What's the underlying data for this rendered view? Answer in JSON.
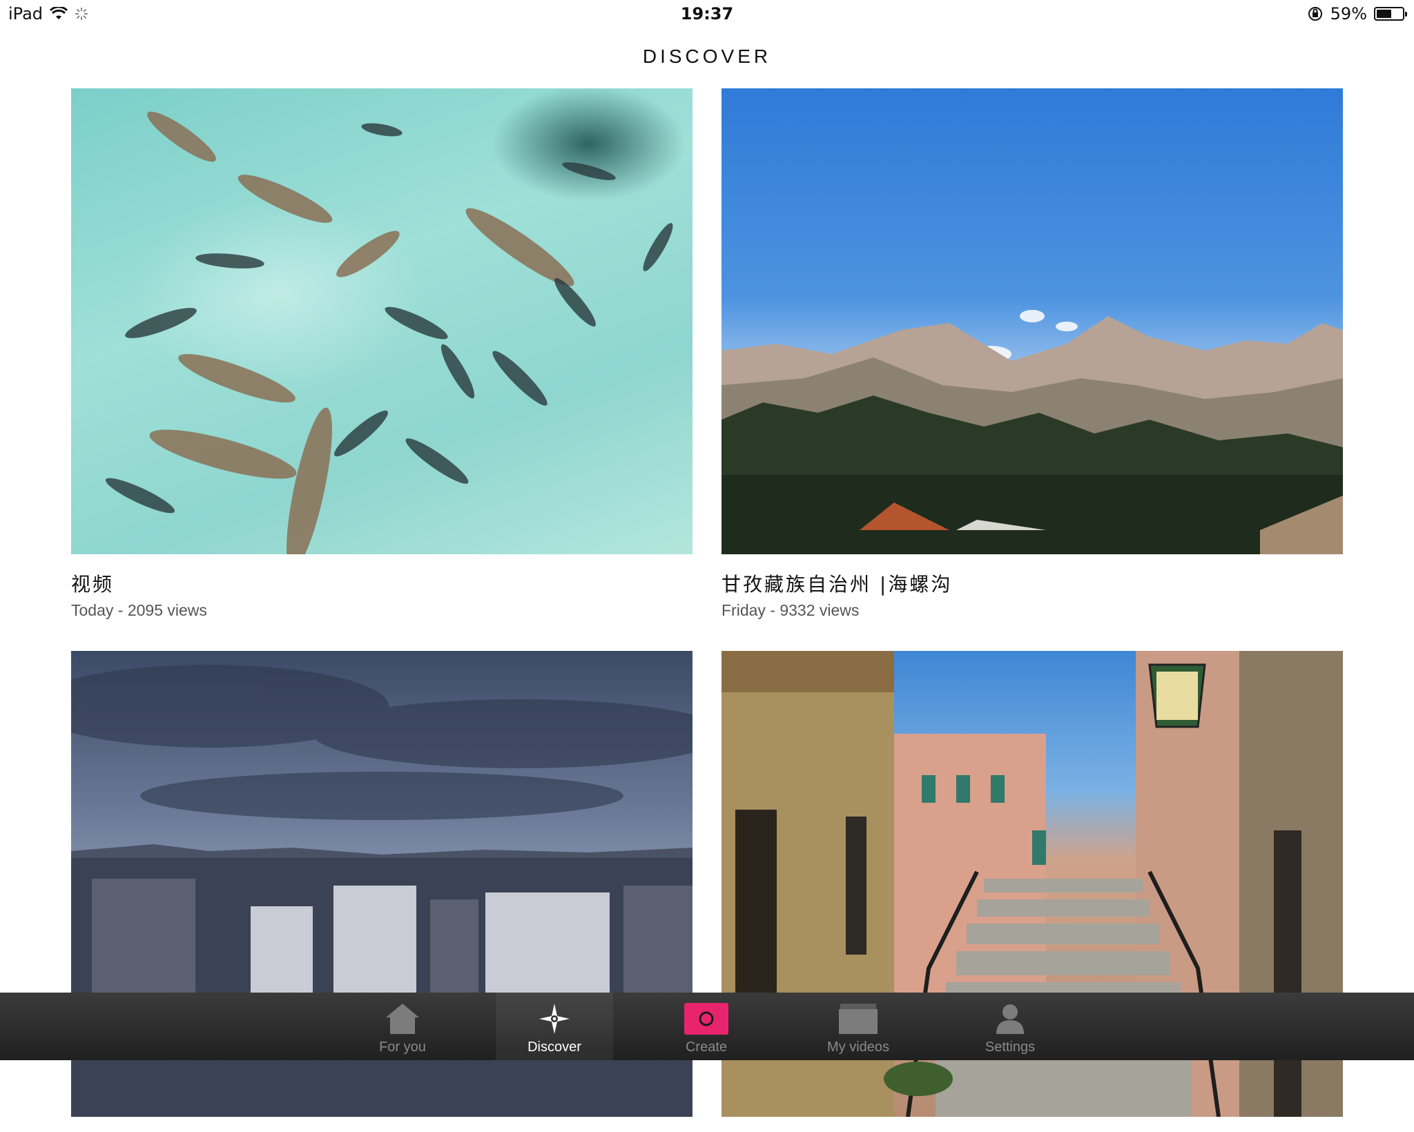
{
  "status_bar": {
    "device": "iPad",
    "time": "19:37",
    "battery_percent_label": "59%",
    "battery_level": 0.59
  },
  "page": {
    "title": "DISCOVER"
  },
  "videos": [
    {
      "title": "视频",
      "meta": "Today - 2095 views"
    },
    {
      "title": "甘孜藏族自治州 |海螺沟",
      "meta": "Friday - 9332 views"
    },
    {
      "title": "",
      "meta": ""
    },
    {
      "title": "",
      "meta": ""
    }
  ],
  "tabs": [
    {
      "label": "For you",
      "icon": "house-icon"
    },
    {
      "label": "Discover",
      "icon": "compass-star-icon",
      "active": true
    },
    {
      "label": "Create",
      "icon": "record-icon",
      "accent": "#e8246f"
    },
    {
      "label": "My videos",
      "icon": "video-stack-icon"
    },
    {
      "label": "Settings",
      "icon": "person-icon"
    }
  ]
}
